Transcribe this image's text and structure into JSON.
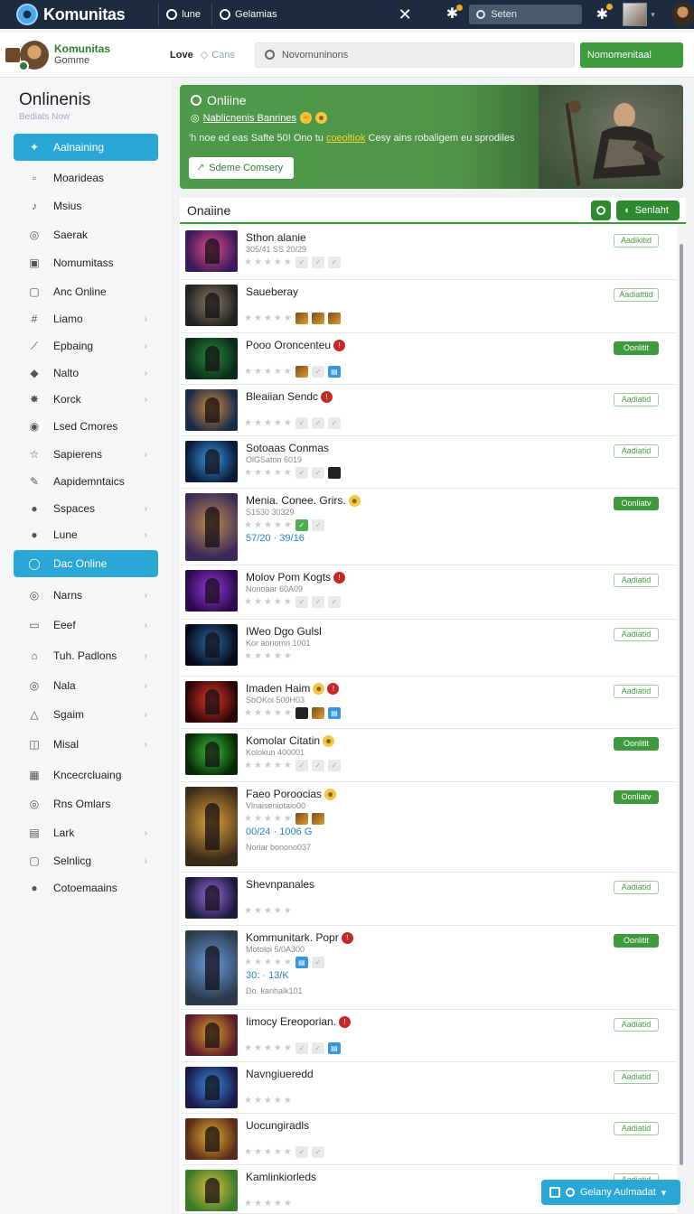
{
  "topbar": {
    "app_name": "Komunitas",
    "tab1": "lune",
    "tab2": "Gelamias",
    "search_placeholder": "Seten",
    "close_glyph": "✕"
  },
  "subheader": {
    "brand_name": "Komunitas",
    "brand_sub": "Gomme",
    "love": "Love",
    "cans": "Cans",
    "search_placeholder": "Novomuninons",
    "action_button": "Nomomenitaal"
  },
  "sidebar": {
    "title": "Onlinenis",
    "subtitle": "Bediats Now",
    "items": [
      {
        "label": "Aalnaining",
        "icon": "megaphone-icon",
        "glyph": "✦",
        "active": true,
        "chevron": false
      },
      {
        "label": "Moarideas",
        "icon": "square-icon",
        "glyph": "▫",
        "active": false,
        "chevron": false
      },
      {
        "label": "Msius",
        "icon": "music-icon",
        "glyph": "♪",
        "active": false,
        "chevron": false
      },
      {
        "label": "Saerak",
        "icon": "globe-icon",
        "glyph": "◎",
        "active": false,
        "chevron": false
      },
      {
        "label": "Nomumitass",
        "icon": "image-icon",
        "glyph": "▣",
        "active": false,
        "chevron": false
      },
      {
        "label": "Anc Online",
        "icon": "frame-icon",
        "glyph": "▢",
        "active": false,
        "chevron": false
      },
      {
        "label": "Liamo",
        "icon": "hash-icon",
        "glyph": "#",
        "active": false,
        "chevron": true
      },
      {
        "label": "Epbaing",
        "icon": "sword-icon",
        "glyph": "⟋",
        "active": false,
        "chevron": true
      },
      {
        "label": "Nalto",
        "icon": "map-icon",
        "glyph": "◆",
        "active": false,
        "chevron": true
      },
      {
        "label": "Korck",
        "icon": "burst-icon",
        "glyph": "✸",
        "active": false,
        "chevron": true
      },
      {
        "label": "Lsed Cmores",
        "icon": "target-icon",
        "glyph": "◉",
        "active": false,
        "chevron": false
      },
      {
        "label": "Sapierens",
        "icon": "star-icon",
        "glyph": "☆",
        "active": false,
        "chevron": true
      },
      {
        "label": "Aapidemntaics",
        "icon": "pen-icon",
        "glyph": "✎",
        "active": false,
        "chevron": false
      },
      {
        "label": "Sspaces",
        "icon": "coin-icon",
        "glyph": "●",
        "active": false,
        "chevron": true
      },
      {
        "label": "Lune",
        "icon": "dot-icon",
        "glyph": "●",
        "active": false,
        "chevron": true
      },
      {
        "label": "Dac Online",
        "icon": "leaf-icon",
        "glyph": "◯",
        "active": true,
        "chevron": false
      },
      {
        "label": "Narns",
        "icon": "spiral-icon",
        "glyph": "◎",
        "active": false,
        "chevron": true
      },
      {
        "label": "Eeef",
        "icon": "monitor-icon",
        "glyph": "▭",
        "active": false,
        "chevron": true
      },
      {
        "label": "Tuh. Padlons",
        "icon": "home-icon",
        "glyph": "⌂",
        "active": false,
        "chevron": true
      },
      {
        "label": "Nala",
        "icon": "ring-icon",
        "glyph": "◎",
        "active": false,
        "chevron": true
      },
      {
        "label": "Sgaim",
        "icon": "bell-icon",
        "glyph": "△",
        "active": false,
        "chevron": true
      },
      {
        "label": "Misal",
        "icon": "book-icon",
        "glyph": "◫",
        "active": false,
        "chevron": true
      },
      {
        "label": "Kncecrcluaing",
        "icon": "grid-icon",
        "glyph": "▦",
        "active": false,
        "chevron": false
      },
      {
        "label": "Rns Omlars",
        "icon": "disc-icon",
        "glyph": "◎",
        "active": false,
        "chevron": false
      },
      {
        "label": "Lark",
        "icon": "table-icon",
        "glyph": "▤",
        "active": false,
        "chevron": true
      },
      {
        "label": "Selnlicg",
        "icon": "tray-icon",
        "glyph": "▢",
        "active": false,
        "chevron": true
      },
      {
        "label": "Cotoemaains",
        "icon": "compass-icon",
        "glyph": "●",
        "active": false,
        "chevron": false
      }
    ]
  },
  "banner": {
    "title": "Onliine",
    "tag": "Nablicnenis Banrines",
    "desc_before": "'h noe ed eas Safte 50! Ono tu ",
    "desc_highlight": "coeoltiok",
    "desc_after": " Cesy ains robaligem eu sprodiles",
    "button": "Sdeme Comsery"
  },
  "list": {
    "title": "Onaiine",
    "sort_label": "Senlaht",
    "rows": [
      {
        "title": "Sthon alanie",
        "meta": "305/41 SS 20/29",
        "stats": "",
        "meta2": "",
        "tag": "Aadikitid",
        "tag_on": false,
        "red": false,
        "emoji": false
      },
      {
        "title": "Saueberay",
        "meta": "",
        "stats": "",
        "meta2": "",
        "tag": "Aadiatttid",
        "tag_on": false,
        "red": false,
        "emoji": false
      },
      {
        "title": "Pooo Oroncenteu",
        "meta": "",
        "stats": "",
        "meta2": "",
        "tag": "Oonlitit",
        "tag_on": true,
        "red": true,
        "emoji": false
      },
      {
        "title": "Bleaiian Sendc",
        "meta": "",
        "stats": "",
        "meta2": "",
        "tag": "Aadiatid",
        "tag_on": false,
        "red": true,
        "emoji": false
      },
      {
        "title": "Sotoaas Conmas",
        "meta": "OlGSaton 6019",
        "stats": "",
        "meta2": "",
        "tag": "Aadiatid",
        "tag_on": false,
        "red": false,
        "emoji": false
      },
      {
        "title": "Menia. Conee. Grirs.",
        "meta": "S1530 30329",
        "stats": "57/20 · 39/16",
        "meta2": "",
        "tag": "Oonliatv",
        "tag_on": true,
        "red": false,
        "emoji": true
      },
      {
        "title": "Molov Pom Kogts",
        "meta": "Nonoaar 60A09",
        "stats": "",
        "meta2": "",
        "tag": "Aadiatid",
        "tag_on": false,
        "red": true,
        "emoji": false
      },
      {
        "title": "IWeo Dgo Gulsl",
        "meta": "Kor aonomn 1001",
        "stats": "",
        "meta2": "",
        "tag": "Aadiatid",
        "tag_on": false,
        "red": false,
        "emoji": false
      },
      {
        "title": "Imaden Haim",
        "meta": "SbOKoi 500H03",
        "stats": "",
        "meta2": "",
        "tag": "Aadiatid",
        "tag_on": false,
        "red": true,
        "emoji": true
      },
      {
        "title": "Komolar Citatin",
        "meta": "Kolokun 400001",
        "stats": "",
        "meta2": "",
        "tag": "Oonlitit",
        "tag_on": true,
        "red": false,
        "emoji": true
      },
      {
        "title": "Faeo Poroocias",
        "meta": "Vlnaiseniotaio00",
        "stats": "00/24 · 1006 G",
        "meta2": "Noriar bonono037",
        "tag": "Oonliatv",
        "tag_on": true,
        "red": false,
        "emoji": true
      },
      {
        "title": "Shevnpanales",
        "meta": "",
        "stats": "",
        "meta2": "",
        "tag": "Aadiatid",
        "tag_on": false,
        "red": false,
        "emoji": false
      },
      {
        "title": "Kommunitark. Popr",
        "meta": "Motoloi 5/0A300",
        "stats": "30: · 13/K",
        "meta2": "Do. kanhalk101",
        "tag": "Oonlitit",
        "tag_on": true,
        "red": true,
        "emoji": false
      },
      {
        "title": "Iimocy Ereoporian.",
        "meta": "",
        "stats": "",
        "meta2": "",
        "tag": "Aadiatid",
        "tag_on": false,
        "red": true,
        "emoji": false
      },
      {
        "title": "Navngiueredd",
        "meta": "",
        "stats": "",
        "meta2": "",
        "tag": "Aadiatid",
        "tag_on": false,
        "red": false,
        "emoji": false
      },
      {
        "title": "Uocungiradls",
        "meta": "",
        "stats": "",
        "meta2": "",
        "tag": "Aadiatid",
        "tag_on": false,
        "red": false,
        "emoji": false
      },
      {
        "title": "Kamlinkiorleds",
        "meta": "",
        "stats": "",
        "meta2": "",
        "tag": "Aadiatid",
        "tag_on": false,
        "red": false,
        "emoji": false
      }
    ]
  },
  "fab": {
    "label": "Gelany Aulmadat"
  },
  "colors": {
    "accent_blue": "#2ba7d6",
    "accent_green": "#3d9a3d",
    "topbar": "#1c2b3f"
  }
}
